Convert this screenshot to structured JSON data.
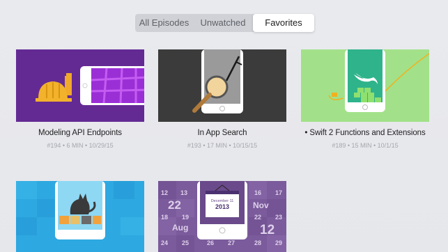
{
  "tabs": [
    {
      "label": "All Episodes"
    },
    {
      "label": "Unwatched"
    },
    {
      "label": "Favorites"
    }
  ],
  "selected_tab": "Favorites",
  "episodes": [
    {
      "title": "Modeling API Endpoints",
      "meta": "#194 • 6 MIN • 10/29/15",
      "thumbnail": "hardhat-phone-purple",
      "color": "#6a2b9a"
    },
    {
      "title": "In App Search",
      "meta": "#193 • 17 MIN • 10/15/15",
      "thumbnail": "magnifier-phone-dark",
      "color": "#3a3a3a"
    },
    {
      "title": "• Swift 2 Functions and Extensions",
      "meta": "#189 • 15 MIN • 10/1/15",
      "thumbnail": "swift-logo-phone-green",
      "color": "#a6e48c"
    },
    {
      "title": "",
      "meta": "",
      "thumbnail": "cat-phone-blue",
      "color": "#2fa9e1"
    },
    {
      "title": "",
      "meta": "",
      "thumbnail": "calendar-phone-purple",
      "color": "#7a5a9a"
    }
  ],
  "calendar_thumb": {
    "numbers": [
      "12",
      "13",
      "16",
      "17",
      "22",
      "18",
      "19",
      "22",
      "23",
      "24",
      "25",
      "26",
      "27",
      "28",
      "29"
    ],
    "month_left": "Aug",
    "month_right": "Nov",
    "big_right": "12",
    "card_date": "December 11",
    "card_year": "2013"
  }
}
